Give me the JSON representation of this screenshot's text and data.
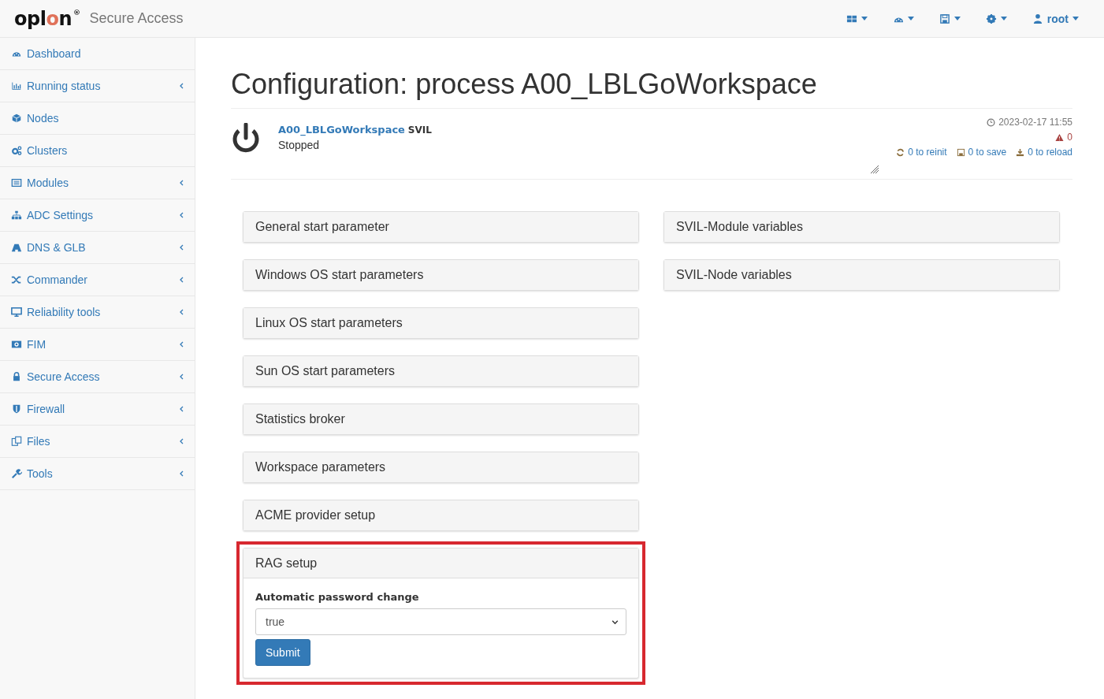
{
  "header": {
    "logo": {
      "before": "opl",
      "accent": "o",
      "after": "n",
      "mark": "®"
    },
    "product": "Secure Access",
    "user_menu": {
      "label": "root"
    }
  },
  "sidebar": {
    "items": [
      {
        "label": "Dashboard",
        "expandable": false
      },
      {
        "label": "Running status",
        "expandable": true
      },
      {
        "label": "Nodes",
        "expandable": false
      },
      {
        "label": "Clusters",
        "expandable": false
      },
      {
        "label": "Modules",
        "expandable": true
      },
      {
        "label": "ADC Settings",
        "expandable": true
      },
      {
        "label": "DNS & GLB",
        "expandable": true
      },
      {
        "label": "Commander",
        "expandable": true
      },
      {
        "label": "Reliability tools",
        "expandable": true
      },
      {
        "label": "FIM",
        "expandable": true
      },
      {
        "label": "Secure Access",
        "expandable": true
      },
      {
        "label": "Firewall",
        "expandable": true
      },
      {
        "label": "Files",
        "expandable": true
      },
      {
        "label": "Tools",
        "expandable": true
      }
    ]
  },
  "page_title": "Configuration: process A00_LBLGoWorkspace",
  "process": {
    "name": "A00_LBLGoWorkspace",
    "environment": "SVIL",
    "status": "Stopped",
    "timestamp": "2023-02-17 11:55",
    "warnings": "0",
    "reinit": "0 to reinit",
    "save": "0 to save",
    "reload": "0 to reload"
  },
  "panels": {
    "left": [
      {
        "title": "General start parameter",
        "expanded": false
      },
      {
        "title": "Windows OS start parameters",
        "expanded": false
      },
      {
        "title": "Linux OS start parameters",
        "expanded": false
      },
      {
        "title": "Sun OS start parameters",
        "expanded": false
      },
      {
        "title": "Statistics broker",
        "expanded": false
      },
      {
        "title": "Workspace parameters",
        "expanded": false
      },
      {
        "title": "ACME provider setup",
        "expanded": false
      },
      {
        "title": "RAG setup",
        "expanded": true,
        "highlighted": true,
        "field": {
          "label": "Automatic password change",
          "value": "true"
        },
        "submit": "Submit"
      }
    ],
    "right": [
      {
        "title": "SVIL-Module variables",
        "expanded": false
      },
      {
        "title": "SVIL-Node variables",
        "expanded": false
      }
    ]
  }
}
